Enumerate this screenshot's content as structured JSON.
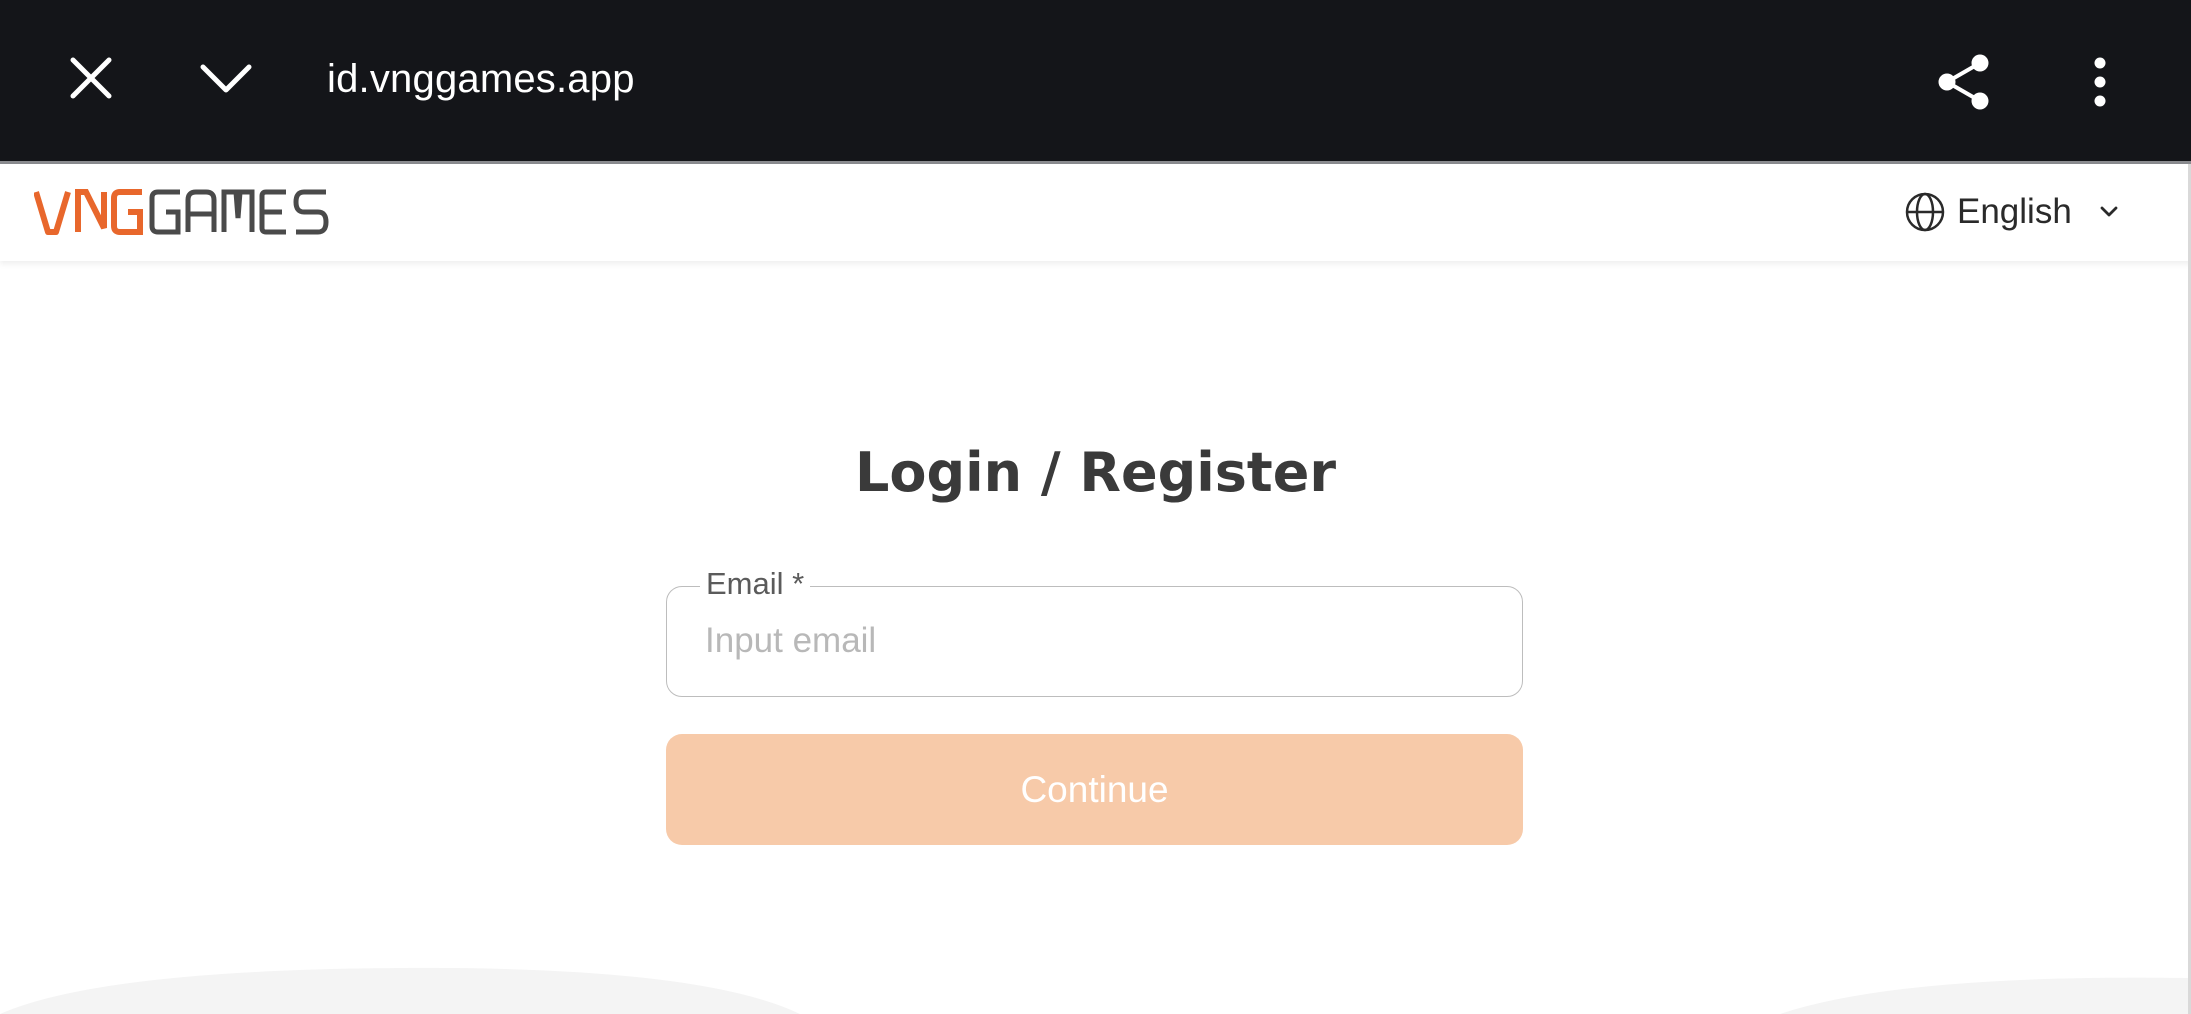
{
  "browser": {
    "url": "id.vnggames.app",
    "icons": {
      "close": "close-icon",
      "minimize": "chevron-down-icon",
      "share": "share-icon",
      "more": "more-vertical-icon"
    },
    "bar_color": "#141519"
  },
  "header": {
    "logo_text": "VNGGAMES",
    "logo_colors": {
      "accent": "#e8672c",
      "dark": "#4a4a4a"
    },
    "language": {
      "label": "English",
      "icon": "globe-icon",
      "dropdown_icon": "chevron-down-icon"
    }
  },
  "form": {
    "title": "Login / Register",
    "email": {
      "label": "Email *",
      "placeholder": "Input email",
      "value": ""
    },
    "continue_label": "Continue",
    "continue_color": "#f7caa9"
  }
}
